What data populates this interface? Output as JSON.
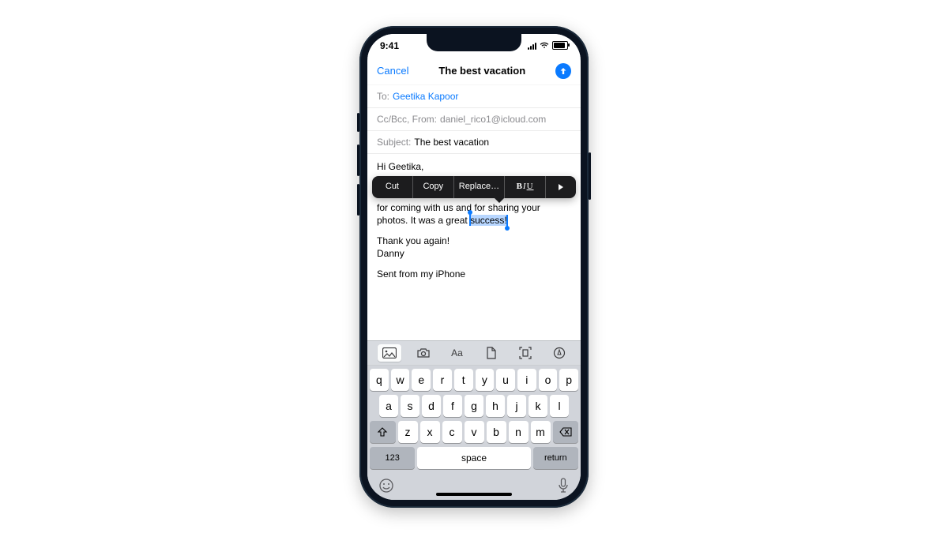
{
  "statusbar": {
    "time": "9:41"
  },
  "nav": {
    "cancel_label": "Cancel",
    "title": "The best vacation"
  },
  "fields": {
    "to_label": "To:",
    "to_value": "Geetika Kapoor",
    "ccbcc_label": "Cc/Bcc, From:",
    "ccbcc_value": "daniel_rico1@icloud.com",
    "subject_label": "Subject:",
    "subject_value": "The best vacation"
  },
  "body": {
    "greeting": "Hi Geetika,",
    "line2a": "for coming with us and for sharing your",
    "line2b_pre": "photos. It was a great ",
    "line2b_sel": "success!",
    "thanks": "Thank you again!",
    "sig_name": "Danny",
    "sent_from": "Sent from my iPhone"
  },
  "editmenu": {
    "cut": "Cut",
    "copy": "Copy",
    "replace": "Replace…",
    "biu_b": "B",
    "biu_i": "I",
    "biu_u": "U"
  },
  "keyboard": {
    "row1": [
      "q",
      "w",
      "e",
      "r",
      "t",
      "y",
      "u",
      "i",
      "o",
      "p"
    ],
    "row2": [
      "a",
      "s",
      "d",
      "f",
      "g",
      "h",
      "j",
      "k",
      "l"
    ],
    "row3": [
      "z",
      "x",
      "c",
      "v",
      "b",
      "n",
      "m"
    ],
    "num_label": "123",
    "space_label": "space",
    "return_label": "return",
    "format_label": "Aa"
  }
}
